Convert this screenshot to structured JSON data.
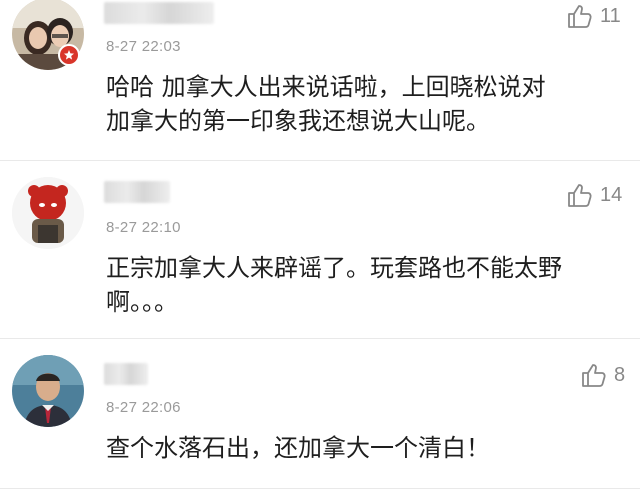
{
  "comments": [
    {
      "timestamp": "8-27 22:03",
      "content": "哈哈 加拿大人出来说话啦，上回晓松说对加拿大的第一印象我还想说大山呢。",
      "likes": "11",
      "icon": "thumbs-up-icon"
    },
    {
      "timestamp": "8-27 22:10",
      "content": "正宗加拿大人来辟谣了。玩套路也不能太野啊。。。",
      "likes": "14",
      "icon": "thumbs-up-icon"
    },
    {
      "timestamp": "8-27 22:06",
      "content": "查个水落石出，还加拿大一个清白！",
      "likes": "8",
      "icon": "thumbs-up-icon"
    }
  ],
  "colors": {
    "badge": "#d9352a",
    "timestamp": "#9a9a9a",
    "divider": "#e9e9e9"
  }
}
